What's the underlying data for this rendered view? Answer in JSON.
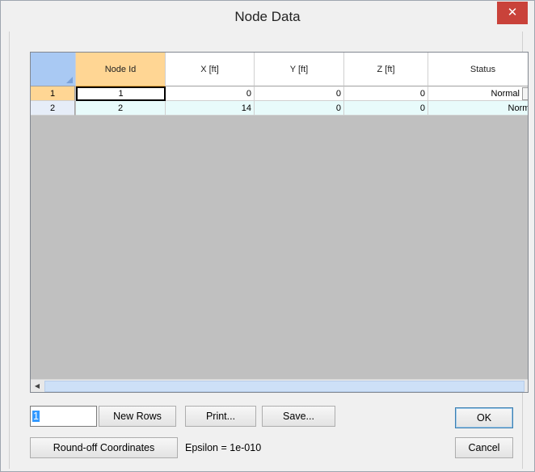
{
  "window": {
    "title": "Node Data",
    "close_glyph": "✕"
  },
  "grid": {
    "columns": [
      "Node Id",
      "X [ft]",
      "Y [ft]",
      "Z [ft]",
      "Status"
    ],
    "rows": [
      {
        "row_number": "1",
        "node_id": "1",
        "x": "0",
        "y": "0",
        "z": "0",
        "status": "Normal"
      },
      {
        "row_number": "2",
        "node_id": "2",
        "x": "14",
        "y": "0",
        "z": "0",
        "status": "Normal"
      }
    ],
    "dropdown_glyph": "∨",
    "scroll_up": "▲",
    "scroll_down": "▼",
    "scroll_left": "◀",
    "scroll_right": "▶"
  },
  "controls": {
    "rows_input_value": "1",
    "new_rows_label": "New Rows",
    "print_label": "Print...",
    "save_label": "Save...",
    "ok_label": "OK",
    "cancel_label": "Cancel",
    "round_off_label": "Round-off Coordinates",
    "epsilon_text": "Epsilon = 1e-010"
  },
  "colors": {
    "close_button": "#c9423a",
    "active_header": "#ffd694",
    "corner_header": "#a9c9f3",
    "grid_background": "#c0c0c0",
    "row2_background": "#e8fbfb"
  }
}
